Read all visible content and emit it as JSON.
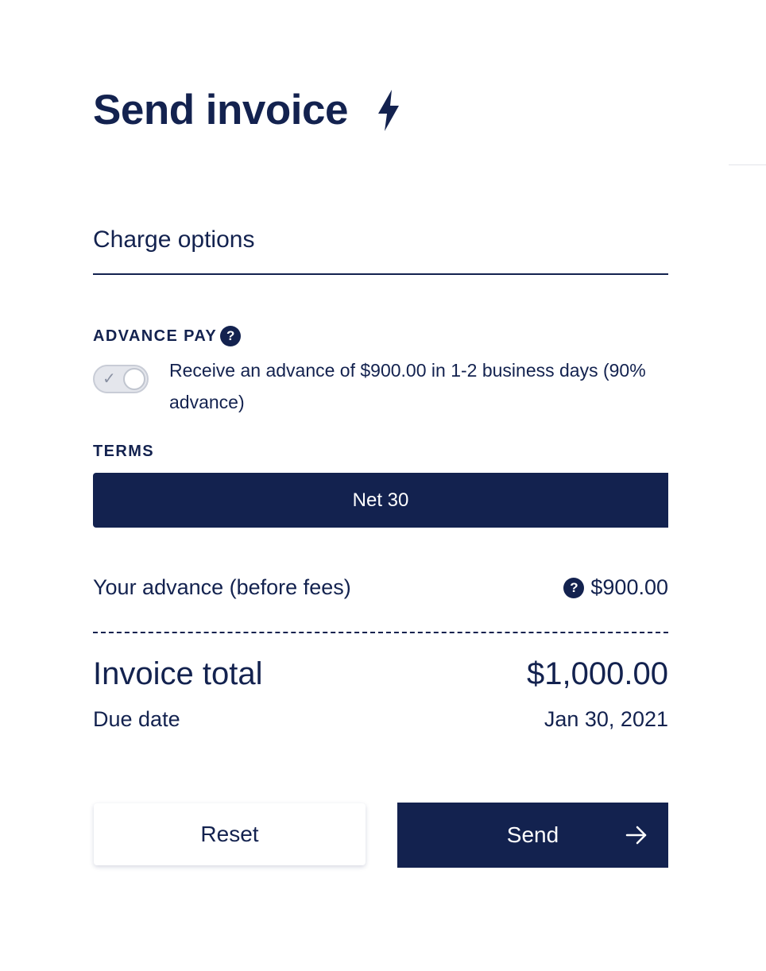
{
  "header": {
    "title": "Send invoice",
    "title_icon": "bolt-icon"
  },
  "charge_options": {
    "section_title": "Charge options",
    "advance_pay": {
      "label": "ADVANCE PAY",
      "help_icon": "question-circle-icon",
      "toggle_state": "on",
      "description": "Receive an advance of $900.00 in 1-2 business days (90% advance)"
    },
    "terms": {
      "label": "TERMS",
      "selected": "Net 30"
    }
  },
  "summary": {
    "advance_label": "Your advance (before fees)",
    "advance_amount": "$900.00",
    "invoice_total_label": "Invoice total",
    "invoice_total_value": "$1,000.00",
    "due_date_label": "Due date",
    "due_date_value": "Jan 30, 2021"
  },
  "actions": {
    "reset_label": "Reset",
    "send_label": "Send",
    "send_icon": "arrow-right-icon"
  },
  "colors": {
    "primary": "#13224f",
    "background": "#ffffff",
    "toggle_track": "#e4e6ec"
  }
}
